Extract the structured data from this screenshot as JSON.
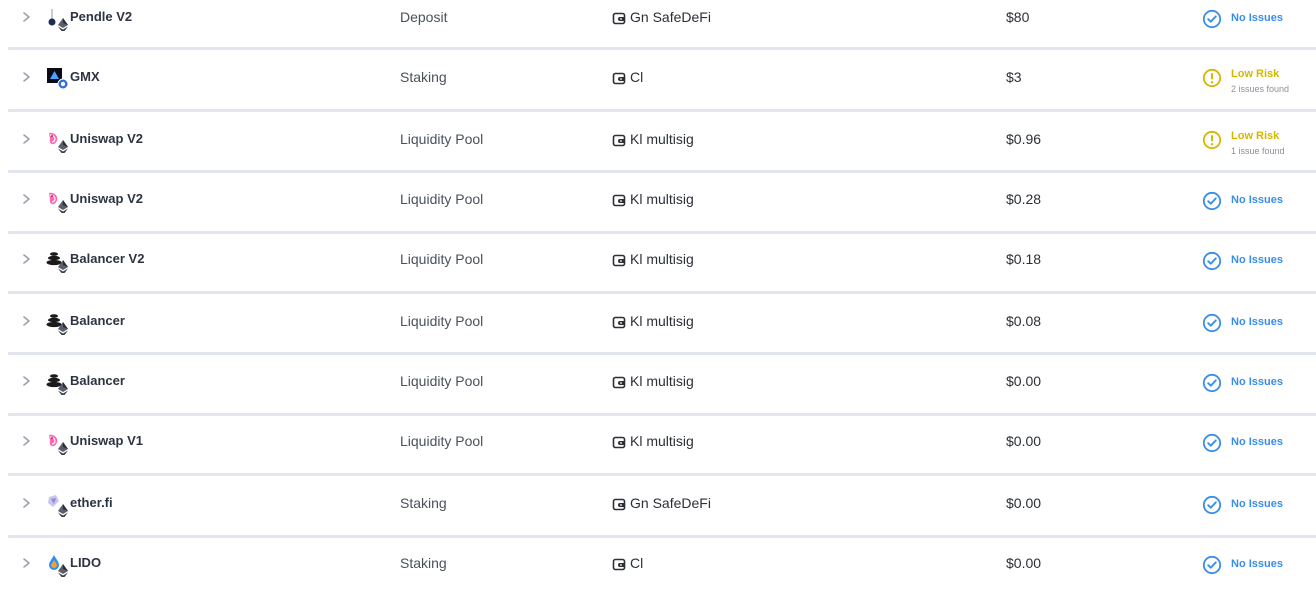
{
  "colors": {
    "no_issues": "#3a8ee6",
    "low_risk": "#d4b800",
    "divider": "#e3e6ee",
    "chevron": "#9aa1ad"
  },
  "rows": [
    {
      "protocol": "Pendle V2",
      "icon": "pendle-icon",
      "type": "Deposit",
      "wallet_icon": "wallet-icon",
      "wallet": "Gn SafeDeFi",
      "value": "$80",
      "status": "ok",
      "status_label": "No Issues",
      "status_sub": ""
    },
    {
      "protocol": "GMX",
      "icon": "gmx-icon",
      "type": "Staking",
      "wallet_icon": "wallet-icon",
      "wallet": "Cl",
      "value": "$3",
      "status": "warn",
      "status_label": "Low Risk",
      "status_sub": "2 issues found"
    },
    {
      "protocol": "Uniswap V2",
      "icon": "uniswap-icon",
      "type": "Liquidity Pool",
      "wallet_icon": "wallet-icon",
      "wallet": "Kl multisig",
      "value": "$0.96",
      "status": "warn",
      "status_label": "Low Risk",
      "status_sub": "1 issue found"
    },
    {
      "protocol": "Uniswap V2",
      "icon": "uniswap-icon",
      "type": "Liquidity Pool",
      "wallet_icon": "wallet-icon",
      "wallet": "Kl multisig",
      "value": "$0.28",
      "status": "ok",
      "status_label": "No Issues",
      "status_sub": ""
    },
    {
      "protocol": "Balancer V2",
      "icon": "balancer-icon",
      "type": "Liquidity Pool",
      "wallet_icon": "wallet-icon",
      "wallet": "Kl multisig",
      "value": "$0.18",
      "status": "ok",
      "status_label": "No Issues",
      "status_sub": ""
    },
    {
      "protocol": "Balancer",
      "icon": "balancer-icon",
      "type": "Liquidity Pool",
      "wallet_icon": "wallet-icon",
      "wallet": "Kl multisig",
      "value": "$0.08",
      "status": "ok",
      "status_label": "No Issues",
      "status_sub": ""
    },
    {
      "protocol": "Balancer",
      "icon": "balancer-icon",
      "type": "Liquidity Pool",
      "wallet_icon": "wallet-icon",
      "wallet": "Kl multisig",
      "value": "$0.00",
      "status": "ok",
      "status_label": "No Issues",
      "status_sub": ""
    },
    {
      "protocol": "Uniswap V1",
      "icon": "uniswap-icon",
      "type": "Liquidity Pool",
      "wallet_icon": "wallet-icon",
      "wallet": "Kl multisig",
      "value": "$0.00",
      "status": "ok",
      "status_label": "No Issues",
      "status_sub": ""
    },
    {
      "protocol": "ether.fi",
      "icon": "etherfi-icon",
      "type": "Staking",
      "wallet_icon": "wallet-icon",
      "wallet": "Gn SafeDeFi",
      "value": "$0.00",
      "status": "ok",
      "status_label": "No Issues",
      "status_sub": ""
    },
    {
      "protocol": "LIDO",
      "icon": "lido-icon",
      "type": "Staking",
      "wallet_icon": "wallet-icon",
      "wallet": "Cl",
      "value": "$0.00",
      "status": "ok",
      "status_label": "No Issues",
      "status_sub": ""
    }
  ]
}
